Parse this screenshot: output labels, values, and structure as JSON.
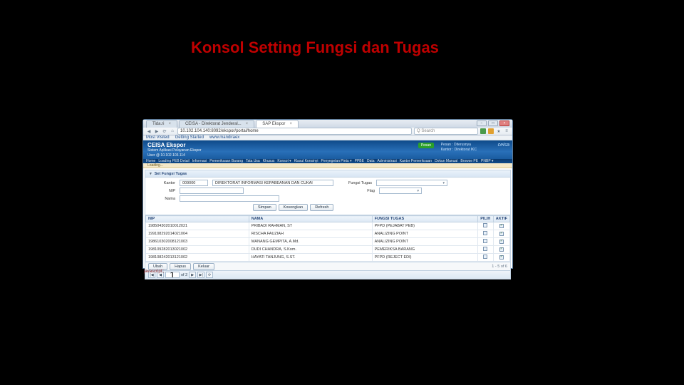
{
  "slide": {
    "title": "Konsol Setting Fungsi dan Tugas"
  },
  "browser": {
    "tabs": [
      {
        "label": "Tida.ri"
      },
      {
        "label": "CEISA - Direktorat Jenderal..."
      },
      {
        "label": "SAP Ekspor"
      }
    ],
    "url": "10.102.104.140:8092/ekspor/portal/home",
    "search_placeholder": "Q  Search",
    "bookmarks": [
      "Most Visited",
      "Getting Started",
      "www.mandiraex"
    ]
  },
  "app": {
    "title": "CEISA Ekspor",
    "subtitle": "Sistem Aplikasi Pelayanan Ekspor",
    "user_line": "User @  10.102.103.114",
    "badge": "Pesan",
    "info1": "Pesan : Diterusnya",
    "info2": "Kantor : Direktorat IKC",
    "logo": "ceisa",
    "menu": [
      "Home",
      "Loading PEB Detail",
      "Informasi",
      "Pemeriksaan Barang",
      "Tata Usa",
      "Khusus",
      "Konsol ▾",
      "Klasul Konsinyi",
      "Penyegelan Pintu ▾",
      "PPBE",
      "Data",
      "Administrasi",
      "Kantor Pemeriksaan",
      "Dokun Manual",
      "Browse PE",
      "PNBP ▾"
    ],
    "status": "Loading..."
  },
  "panel": {
    "title": "Set Fungsi Tugas",
    "labels": {
      "kantor": "Kantor",
      "fungsi": "Fungsi Tugas",
      "nip": "NIP",
      "nama": "Nama"
    },
    "values": {
      "kantor_code": "009000",
      "kantor_name": "DIREKTORAT INFORMASI KEPABEANAN DAN CUKAI",
      "fungsi": "",
      "nip": "",
      "nama": ""
    },
    "buttons": {
      "simpan": "Simpan",
      "kosongkan": "Kosongkan",
      "refresh": "Refresh"
    },
    "actions": {
      "ubah": "Ubah",
      "hapus": "Hapus",
      "keluar": "Keluar"
    },
    "cols": {
      "nip": "NIP",
      "nama": "NAMA",
      "fungsi": "FUNGSI TUGAS",
      "pilih": "PILIH",
      "aktif": "AKTIF"
    },
    "rows": [
      {
        "nip": "198504302010012021",
        "nama": "PRIBADI RAHMAN, ST",
        "fungsi": "PFPD  (PEJABAT PEB)",
        "pilih": false,
        "aktif": true
      },
      {
        "nip": "199108292014021004",
        "nama": "RISCHA FAUZIAH",
        "fungsi": "ANALIZING POINT",
        "pilih": false,
        "aktif": true
      },
      {
        "nip": "198610302008121003",
        "nama": "MANANG GEMPITA, A.Md.",
        "fungsi": "ANALIZING POINT",
        "pilih": false,
        "aktif": true
      },
      {
        "nip": "198109282013021002",
        "nama": "DUDI CHANDRA, S.Kom.",
        "fungsi": "PEMERIKSA BARANG",
        "pilih": false,
        "aktif": true
      },
      {
        "nip": "198108242013121002",
        "nama": "HAYATI TANJUNG, S.ST.",
        "fungsi": "PFPD  (REJECT EDI)",
        "pilih": false,
        "aktif": true
      }
    ],
    "pager": {
      "page": "1",
      "of": "of 2",
      "range": "1 - 5 of 6"
    }
  },
  "footer": {
    "js": "javascript:;"
  }
}
